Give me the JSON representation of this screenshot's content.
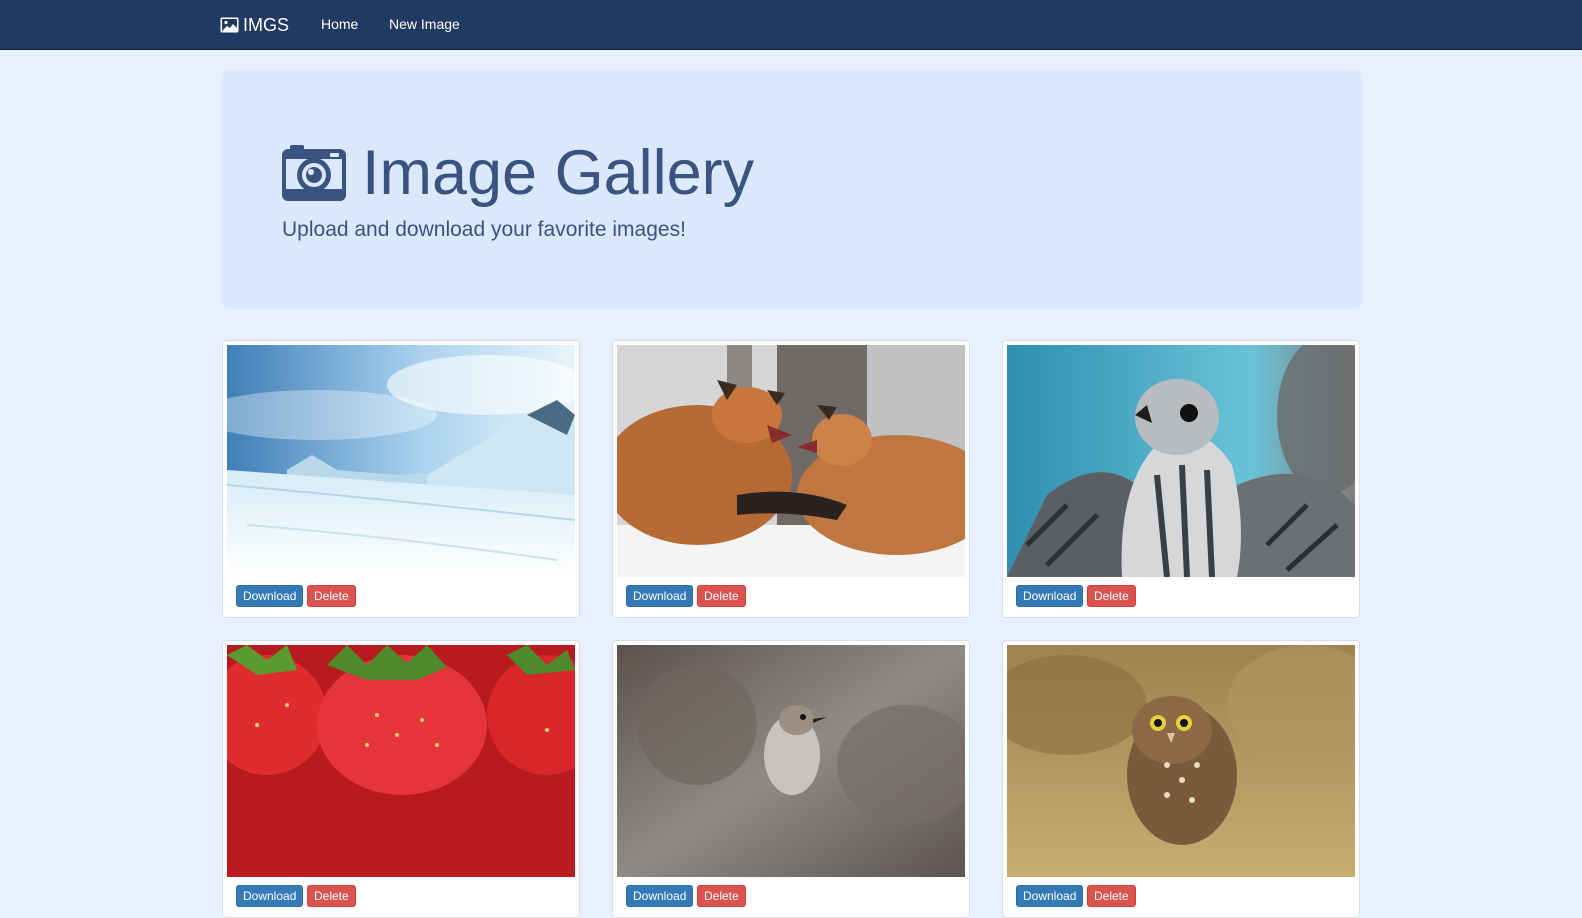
{
  "navbar": {
    "brand": "IMGS",
    "brand_icon": "image-icon",
    "links": [
      "Home",
      "New Image"
    ]
  },
  "hero": {
    "icon": "camera-icon",
    "title": "Image Gallery",
    "subtitle": "Upload and download your favorite images!"
  },
  "gallery": {
    "download_label": "Download",
    "delete_label": "Delete",
    "items": [
      {
        "subject": "snowy mountain landscape"
      },
      {
        "subject": "two foxes fighting in snow"
      },
      {
        "subject": "falcon"
      },
      {
        "subject": "strawberries"
      },
      {
        "subject": "small bird on branch"
      },
      {
        "subject": "owl"
      }
    ]
  },
  "colors": {
    "navbar": "#213a61",
    "background": "#e8f0fe",
    "hero": "#dbe8fd",
    "primary": "#337ab7",
    "danger": "#d9534f"
  }
}
